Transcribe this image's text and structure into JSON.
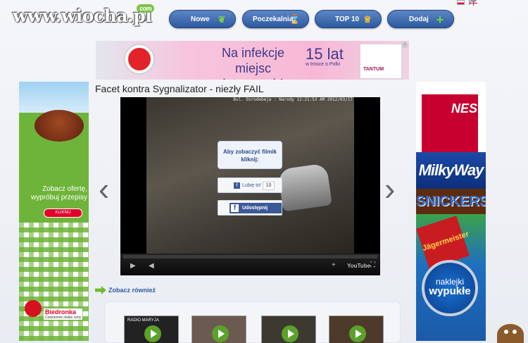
{
  "site": {
    "logo_text": "www.wiocha.pl",
    "logo_badge": "com"
  },
  "nav": [
    {
      "label": "Nowe",
      "icon": "leaf-icon"
    },
    {
      "label": "Poczekalnia",
      "icon": "hourglass-icon"
    },
    {
      "label": "TOP 10",
      "icon": "trophy-icon"
    },
    {
      "label": "Dodaj",
      "icon": "plus-icon"
    }
  ],
  "languages": [
    "pl-flag-icon",
    "en-flag-icon"
  ],
  "top_ad": {
    "line1": "Na infekcje",
    "line2": "miejsc intymnych!",
    "years": "15 lat",
    "years_sub": "w trosce o Polki",
    "product": "TANTUM"
  },
  "post": {
    "title": "Facet kontra Sygnalizator - niezły FAIL"
  },
  "video": {
    "timestamp": "Bul. Ośrodebeja : Narody 12:21:53 AM 2012/03/17",
    "overlay_text": "Aby zobaczyć filmik kliknij:",
    "like_label": "Lubię to!",
    "like_count": "10",
    "share_label": "Udostępnij",
    "controls": {
      "play": "play-icon",
      "volume": "volume-icon",
      "fullscreen": "fullscreen-icon",
      "youtube": "YouTube"
    }
  },
  "left_ad": {
    "text1": "Zobacz ofertę,",
    "text2": "wypróbuj przepisy",
    "cta": "KLIKNIJ",
    "brand": "Biedronka",
    "brand_sub": "Codziennie niskie ceny"
  },
  "right_ad": {
    "coffee": "NES",
    "bar1": "MilkyWay",
    "bar2": "SNICKERS",
    "bottle": "Jägermeister",
    "badge_line1": "naklejki",
    "badge_line2": "wypukłe"
  },
  "see_also": {
    "label": "Zobacz również"
  },
  "thumbnails": [
    {
      "caption": "RADIO MARYJA"
    },
    {
      "caption": ""
    },
    {
      "caption": ""
    },
    {
      "caption": ""
    }
  ],
  "colors": {
    "nav_blue": "#2d5aa0",
    "accent_green": "#6dbb2e",
    "fb_blue": "#3b5998"
  }
}
